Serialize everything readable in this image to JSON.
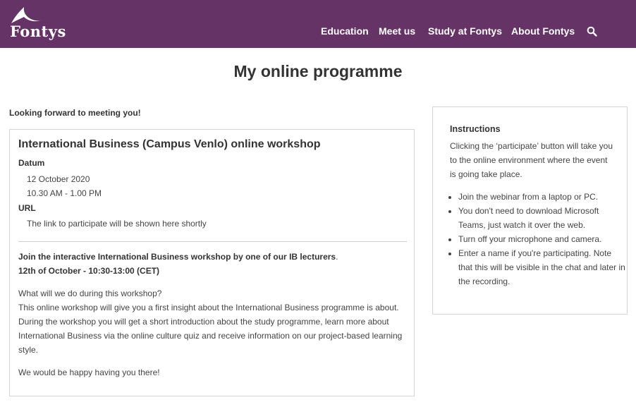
{
  "brand": {
    "logo_text": "Fontys"
  },
  "nav": {
    "items": [
      {
        "label": "Education"
      },
      {
        "label": "Meet us"
      },
      {
        "label": "Study at Fontys"
      },
      {
        "label": "About Fontys"
      }
    ],
    "search_icon": "search-icon"
  },
  "colors": {
    "header_bg": "#663366",
    "text": "#333333",
    "border": "#d6d6d6"
  },
  "page": {
    "title": "My online programme"
  },
  "main": {
    "greeting": "Looking forward to meeting you!",
    "event": {
      "title": "International Business (Campus Venlo) online workshop",
      "datum_label": "Datum",
      "date": "12 October 2020",
      "time": "10.30 AM - 1.00 PM",
      "url_label": "URL",
      "url_text": "The link to participate will be shown here shortly",
      "intro_bold": "Join the interactive International Business workshop by one of our IB lecturers",
      "intro_dot": ".",
      "when": "12th of October - 10:30-13:00 (CET)",
      "question": "What will we do during this workshop?",
      "description": "This online workshop will give you a first insight about the International Business programme is about. During the workshop you will get a short introduction about the study programme, learn more about International Business via the online culture quiz and receive information on our project-based learning style.",
      "closing": "We would be happy having you there!"
    }
  },
  "sidebar": {
    "title": "Instructions",
    "text": "Clicking the ‘participate’ button will take you to the online environment where the event is going take place.",
    "items": [
      "Join the webinar from a laptop or PC.",
      "You don't need to download Microsoft Teams, just watch it over the web.",
      "Turn off your microphone and camera.",
      "Enter a name if you're participating. Note that this will be visible in the chat and later in the recording."
    ]
  }
}
